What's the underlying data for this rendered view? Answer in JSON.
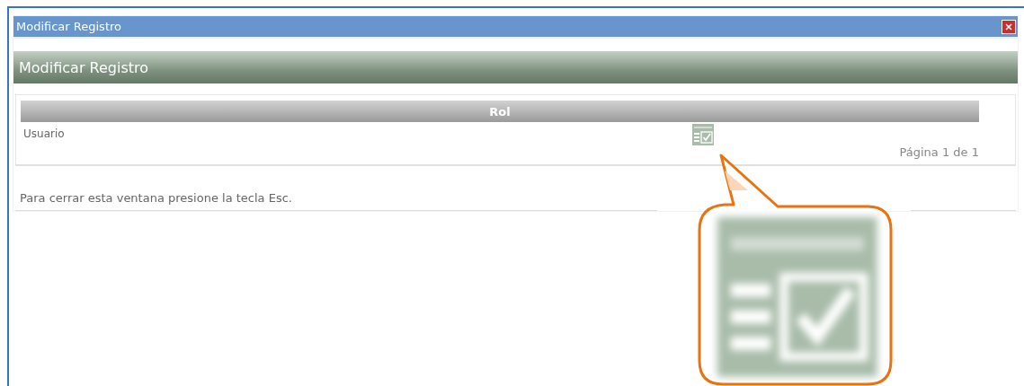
{
  "window": {
    "title": "Modificar Registro"
  },
  "panel": {
    "title": "Modificar Registro"
  },
  "table": {
    "columns": [
      "Rol"
    ],
    "rows": [
      {
        "cells": [
          "Usuario"
        ]
      }
    ],
    "pagination": "Página 1 de 1"
  },
  "footer_note": "Para cerrar esta ventana presione la tecla Esc."
}
